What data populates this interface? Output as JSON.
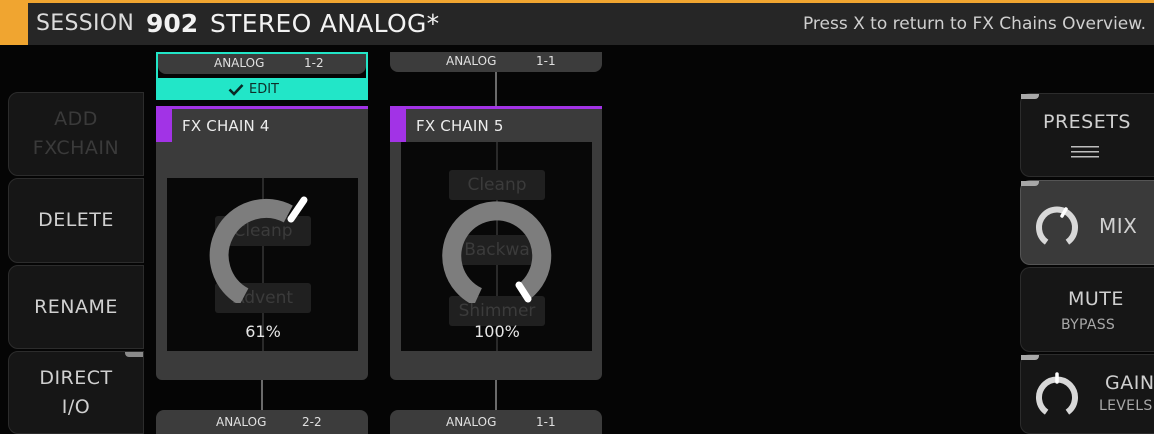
{
  "header": {
    "session_label": "SESSION",
    "session_number": "902",
    "session_name": "STEREO ANALOG*",
    "hint": "Press X to return to FX Chains Overview."
  },
  "left_buttons": [
    {
      "line1": "ADD",
      "line2": "FXCHAIN",
      "enabled": false
    },
    {
      "line1": "DELETE",
      "enabled": true
    },
    {
      "line1": "RENAME",
      "enabled": true
    },
    {
      "line1": "DIRECT",
      "line2": "I/O",
      "enabled": true
    }
  ],
  "right_buttons": {
    "presets": {
      "label": "PRESETS",
      "icon": "menu-icon"
    },
    "mix": {
      "label": "MIX",
      "icon": "knob-icon"
    },
    "mute": {
      "label": "MUTE",
      "sub": "BYPASS"
    },
    "gain": {
      "label": "GAIN",
      "sub": "LEVELS",
      "icon": "knob-icon"
    }
  },
  "chains": [
    {
      "title": "FX CHAIN 4",
      "input": {
        "name": "ANALOG",
        "ch": "1-2"
      },
      "output": {
        "name": "ANALOG",
        "ch": "2-2"
      },
      "selected": true,
      "edit_label": "EDIT",
      "effects": [
        "Cleanp",
        "Advent"
      ],
      "mix_percent": "61%",
      "mix_value": 0.61
    },
    {
      "title": "FX CHAIN 5",
      "input": {
        "name": "ANALOG",
        "ch": "1-1"
      },
      "output": {
        "name": "ANALOG",
        "ch": "1-1"
      },
      "selected": false,
      "effects": [
        "Cleanp",
        "Backwa",
        "Shimmer"
      ],
      "mix_percent": "100%",
      "mix_value": 1.0
    }
  ],
  "colors": {
    "accent_orange": "#f0a530",
    "chain_purple": "#a233e6",
    "edit_teal": "#22e6c8"
  }
}
